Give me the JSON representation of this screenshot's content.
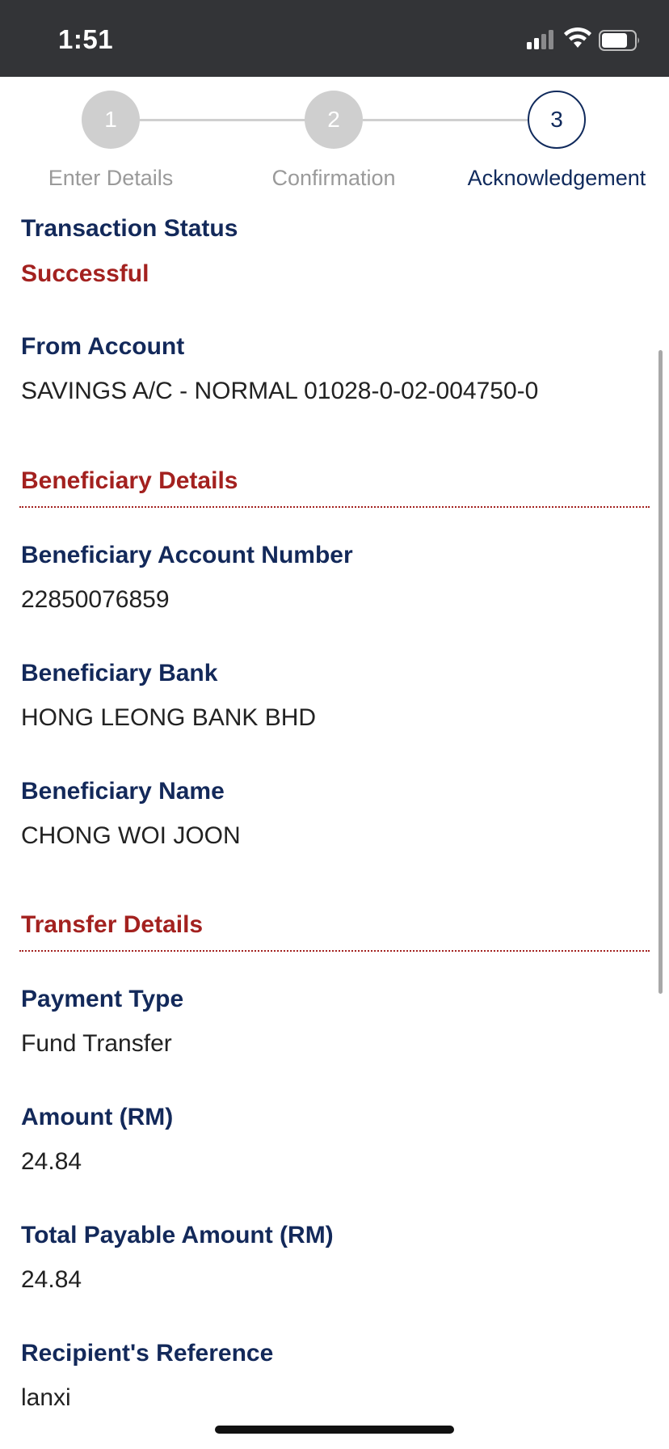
{
  "status_bar": {
    "time": "1:51"
  },
  "stepper": {
    "steps": [
      {
        "number": "1",
        "label": "Enter Details"
      },
      {
        "number": "2",
        "label": "Confirmation"
      },
      {
        "number": "3",
        "label": "Acknowledgement"
      }
    ],
    "active_step": 3
  },
  "transaction": {
    "status_label": "Transaction Status",
    "status_value": "Successful",
    "from_label": "From Account",
    "from_value": "SAVINGS A/C - NORMAL 01028-0-02-004750-0"
  },
  "beneficiary": {
    "section_title": "Beneficiary Details",
    "account_label": "Beneficiary Account Number",
    "account_value": "22850076859",
    "bank_label": "Beneficiary Bank",
    "bank_value": "HONG LEONG BANK BHD",
    "name_label": "Beneficiary Name",
    "name_value": "CHONG WOI JOON"
  },
  "transfer": {
    "section_title": "Transfer Details",
    "payment_type_label": "Payment Type",
    "payment_type_value": "Fund Transfer",
    "amount_label": "Amount (RM)",
    "amount_value": "24.84",
    "total_label": "Total Payable Amount (RM)",
    "total_value": "24.84",
    "reference_label": "Recipient's Reference",
    "reference_value": "lanxi"
  },
  "colors": {
    "navy": "#13295a",
    "accent_red": "#a3211f",
    "status_bar_bg": "#333437"
  }
}
